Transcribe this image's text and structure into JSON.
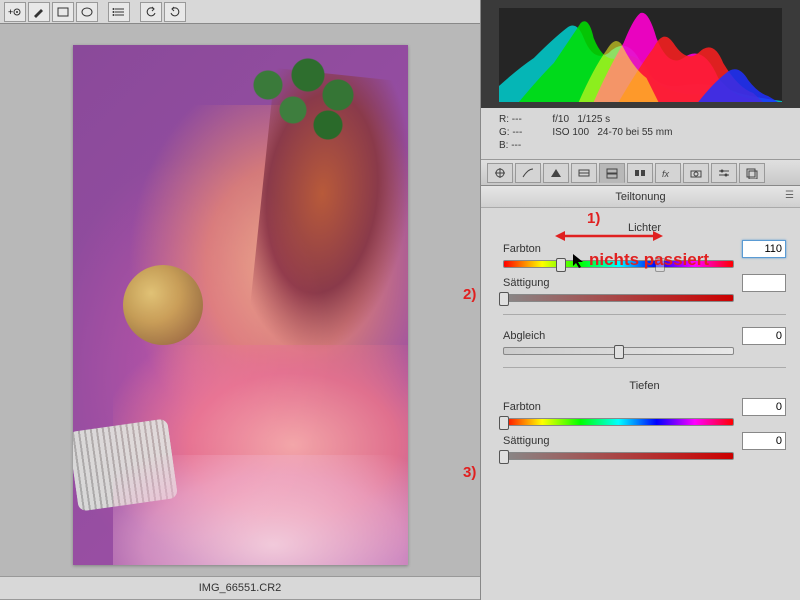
{
  "toolbar": {
    "tools": [
      "eye",
      "brush",
      "rect",
      "ellipse",
      "list",
      "rotate-ccw",
      "rotate-cw"
    ]
  },
  "filename": "IMG_66551.CR2",
  "info": {
    "r": "R:    ---",
    "g": "G:    ---",
    "b": "B:    ---",
    "aperture": "f/10",
    "shutter": "1/125 s",
    "iso": "ISO 100",
    "lens": "24-70 bei 55 mm"
  },
  "panel": {
    "title": "Teiltonung",
    "highlights_title": "Lichter",
    "shadows_title": "Tiefen",
    "labels": {
      "hue": "Farbton",
      "saturation": "Sättigung",
      "balance": "Abgleich"
    },
    "highlights": {
      "hue": "110",
      "saturation": ""
    },
    "balance": "0",
    "shadows": {
      "hue": "0",
      "saturation": "0"
    },
    "slider_pos": {
      "highlights_hue": 25,
      "highlights_hue_ghost": 68,
      "highlights_sat": 0,
      "balance": 50,
      "shadows_hue": 0,
      "shadows_sat": 0
    }
  },
  "annotations": {
    "a1": "1)",
    "a2": "2)",
    "a3": "3)",
    "note": "nichts passiert"
  }
}
